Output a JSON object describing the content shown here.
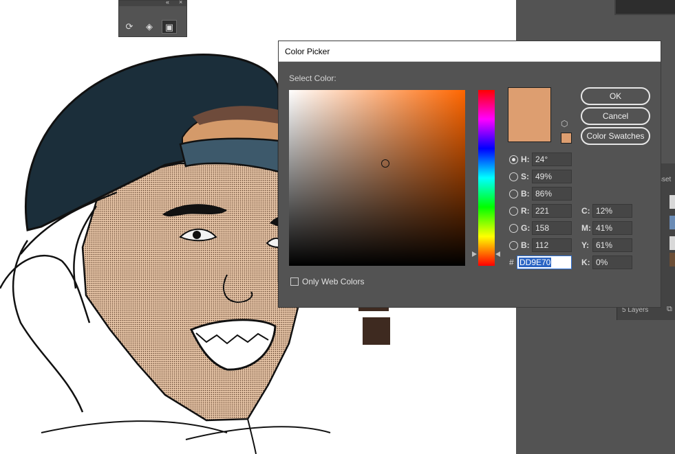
{
  "tool_panel": {
    "collapse_icon": "double-chevron-icon",
    "close_label": "×",
    "buttons": [
      {
        "name": "rotate-view-icon",
        "glyph": "⟳"
      },
      {
        "name": "paint-bucket-icon",
        "glyph": "◈"
      },
      {
        "name": "screen-mode-icon",
        "glyph": "▣"
      }
    ]
  },
  "layers_panel": {
    "tab_partial": "sset",
    "count": "5 Layers"
  },
  "dialog": {
    "title": "Color Picker",
    "select_label": "Select Color:",
    "hue_marker_value": 24,
    "current_color": "#dd9e70",
    "buttons": {
      "ok": "OK",
      "cancel": "Cancel",
      "swatches": "Color Swatches"
    },
    "hsb": [
      {
        "label": "H:",
        "value": "24°",
        "checked": true
      },
      {
        "label": "S:",
        "value": "49%",
        "checked": false
      },
      {
        "label": "B:",
        "value": "86%",
        "checked": false
      }
    ],
    "rgb": [
      {
        "label": "R:",
        "value": "221"
      },
      {
        "label": "G:",
        "value": "158"
      },
      {
        "label": "B:",
        "value": "112"
      }
    ],
    "cmyk": [
      {
        "label": "C:",
        "value": "12%"
      },
      {
        "label": "M:",
        "value": "41%"
      },
      {
        "label": "Y:",
        "value": "61%"
      },
      {
        "label": "K:",
        "value": "0%"
      }
    ],
    "hex_label": "#",
    "hex_value": "DD9E70",
    "only_web_colors": "Only Web Colors"
  }
}
